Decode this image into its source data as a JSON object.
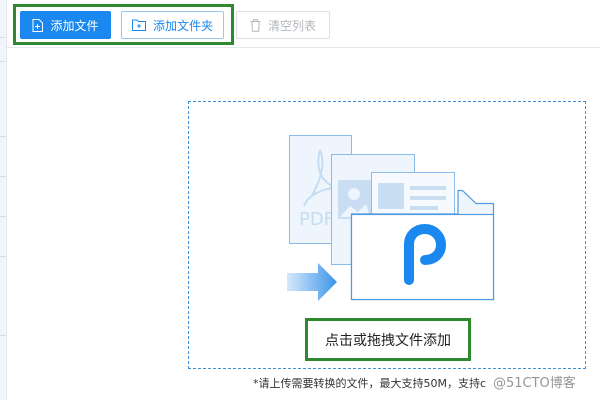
{
  "toolbar": {
    "add_file_label": "添加文件",
    "add_folder_label": "添加文件夹",
    "clear_list_label": "清空列表"
  },
  "drop_zone": {
    "illustration": {
      "document_text": "PDF",
      "icons": [
        "pdf-document-icon",
        "image-document-icon",
        "text-document-icon",
        "folder-icon",
        "arrow-right-icon"
      ]
    },
    "cta_label": "点击或拖拽文件添加"
  },
  "footnote": "*请上传需要转换的文件，最大支持50M，支持c",
  "watermark": "@51CTO博客",
  "colors": {
    "primary": "#1a88ee",
    "highlight": "#2f8a2f",
    "illustration_line": "#8cbde8",
    "illustration_fill": "#eef5fd"
  }
}
